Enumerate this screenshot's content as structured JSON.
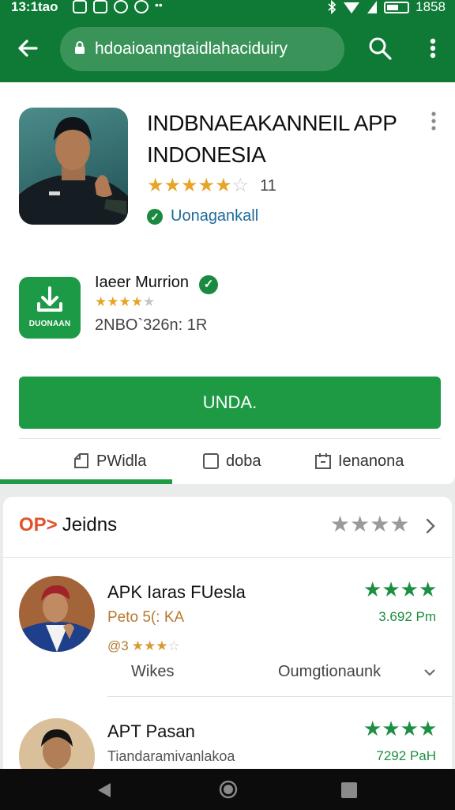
{
  "status_bar": {
    "time": "13:1tao",
    "battery_level": "1858",
    "icons": [
      "notification-icon",
      "image-icon",
      "sync-icon",
      "shield-icon",
      "more-dots-icon",
      "bluetooth-icon",
      "wifi-icon",
      "battery-icon"
    ]
  },
  "browser": {
    "url": "hdoaioanngtaidlahaciduiry"
  },
  "app": {
    "title_line1": "INDBNAEAKANNEIL APP",
    "title_line2": "INDONESIA",
    "rating_count": "11",
    "rating_value": 4.5,
    "verified_label": "Uonagankall"
  },
  "developer": {
    "name": "Iaeer Murrion",
    "icon_label": "DUONAAN",
    "meta": "2NBO`326n: 1R",
    "rating_value": 3.5
  },
  "install_button": {
    "label": "UNDA."
  },
  "tabs": [
    {
      "label": "PWidla",
      "icon": "edit-icon"
    },
    {
      "label": "doba",
      "icon": "square-icon"
    },
    {
      "label": "Ienanona",
      "icon": "calendar-icon"
    }
  ],
  "active_tab_index": 0,
  "reviews_section": {
    "prefix": "OP>",
    "title": "Jeidns",
    "stars": 4
  },
  "reviews": [
    {
      "name": "APK Iaras FUesla",
      "subtitle": "Peto 5(: KA",
      "mini_label": "@3",
      "mini_stars": 3.5,
      "stars": 4,
      "date": "3.692 Pm",
      "footer_left": "Wikes",
      "footer_right": "Oumgtionaunk"
    },
    {
      "name": "APT Pasan",
      "subtitle": "Tiandaramivanlakoa",
      "stars": 4,
      "date": "7292 PaH"
    }
  ],
  "colors": {
    "brand_green": "#0f7a36",
    "button_green": "#1e9a44",
    "star_gold": "#e6a529",
    "link_blue": "#1e6a9a"
  }
}
